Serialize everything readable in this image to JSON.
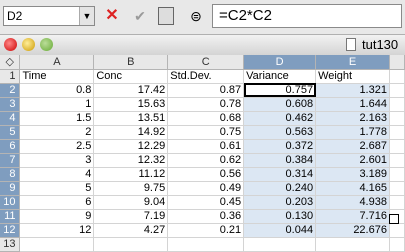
{
  "formula_bar": {
    "cell_reference": "D2",
    "formula": "=C2*C2"
  },
  "window": {
    "title": "tut130"
  },
  "grid": {
    "columns": [
      "A",
      "B",
      "C",
      "D",
      "E"
    ],
    "selected_columns": [
      "D",
      "E"
    ],
    "rows": [
      {
        "n": "1",
        "cells": [
          "Time",
          "Conc",
          "Std.Dev.",
          "Variance",
          "Weight"
        ]
      },
      {
        "n": "2",
        "cells": [
          "0.8",
          "17.42",
          "0.87",
          "0.757",
          "1.321"
        ]
      },
      {
        "n": "3",
        "cells": [
          "1",
          "15.63",
          "0.78",
          "0.608",
          "1.644"
        ]
      },
      {
        "n": "4",
        "cells": [
          "1.5",
          "13.51",
          "0.68",
          "0.462",
          "2.163"
        ]
      },
      {
        "n": "5",
        "cells": [
          "2",
          "14.92",
          "0.75",
          "0.563",
          "1.778"
        ]
      },
      {
        "n": "6",
        "cells": [
          "2.5",
          "12.29",
          "0.61",
          "0.372",
          "2.687"
        ]
      },
      {
        "n": "7",
        "cells": [
          "3",
          "12.32",
          "0.62",
          "0.384",
          "2.601"
        ]
      },
      {
        "n": "8",
        "cells": [
          "4",
          "11.12",
          "0.56",
          "0.314",
          "3.189"
        ]
      },
      {
        "n": "9",
        "cells": [
          "5",
          "9.75",
          "0.49",
          "0.240",
          "4.165"
        ]
      },
      {
        "n": "10",
        "cells": [
          "6",
          "9.04",
          "0.45",
          "0.203",
          "4.938"
        ]
      },
      {
        "n": "11",
        "cells": [
          "9",
          "7.19",
          "0.36",
          "0.130",
          "7.716"
        ]
      },
      {
        "n": "12",
        "cells": [
          "12",
          "4.27",
          "0.21",
          "0.044",
          "22.676"
        ]
      },
      {
        "n": "13",
        "cells": [
          "",
          "",
          "",
          "",
          ""
        ]
      }
    ]
  },
  "colors": {
    "selection_header": "#7f9dbf",
    "selection_fill": "#dce7f3",
    "cancel_icon": "#dd2222"
  }
}
